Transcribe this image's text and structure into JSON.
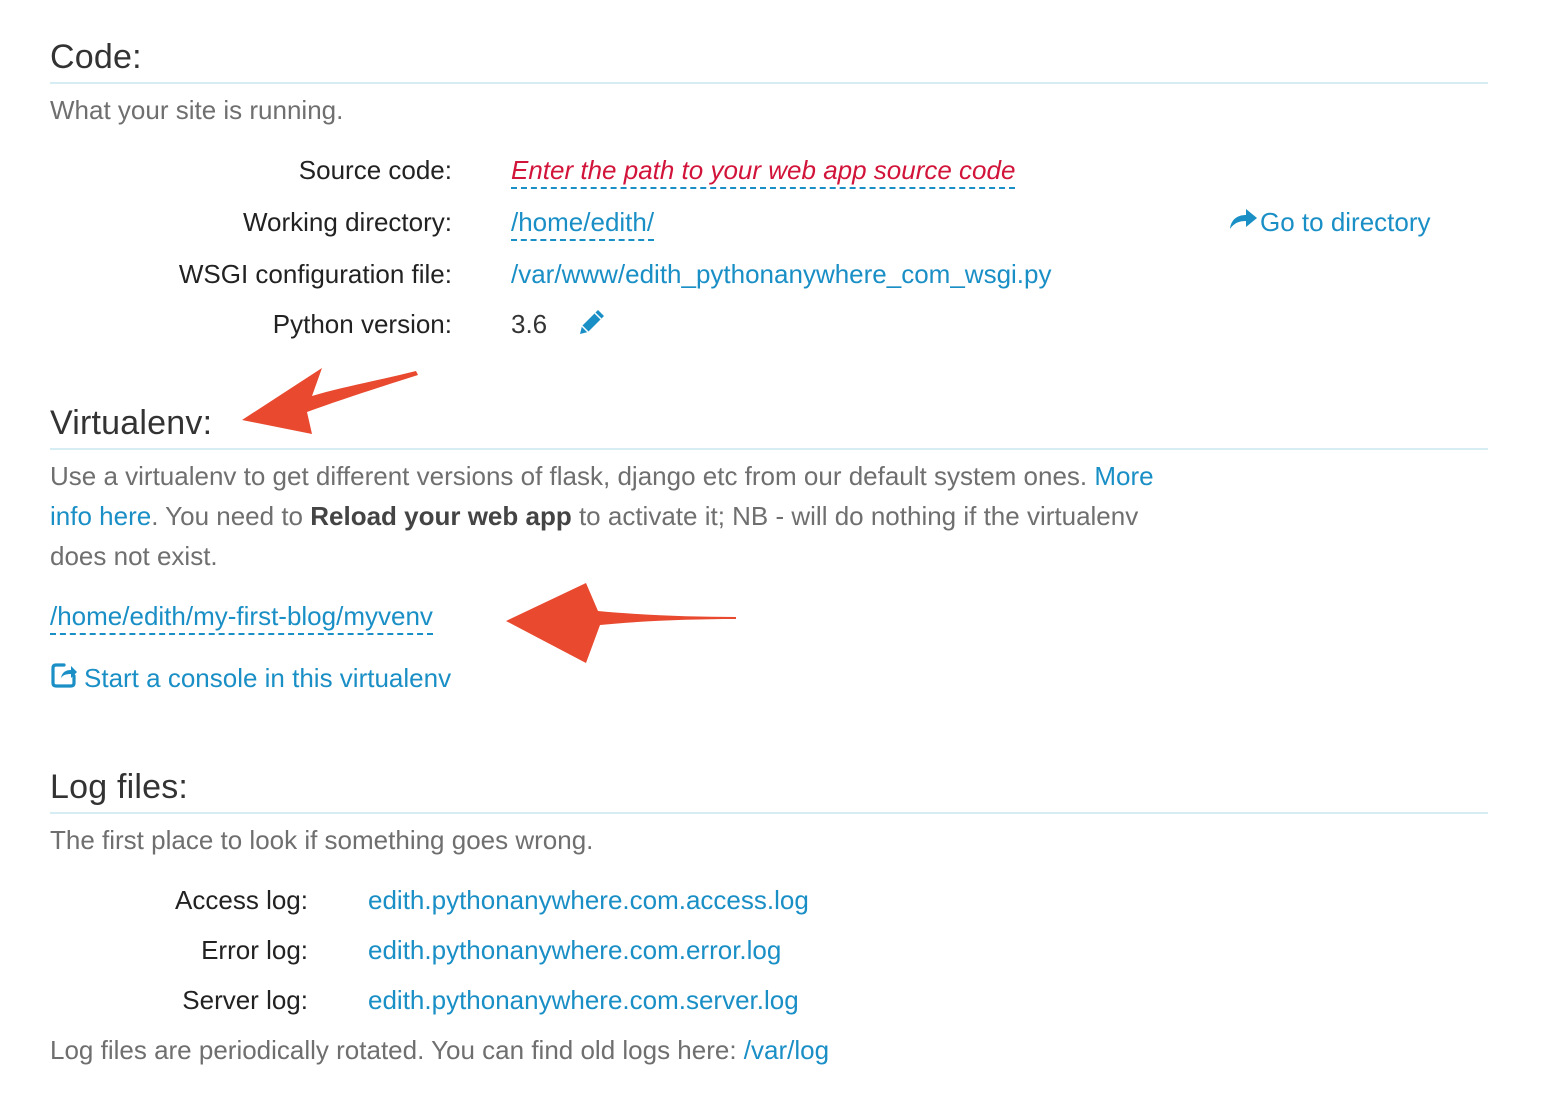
{
  "code": {
    "title": "Code:",
    "subtitle": "What your site is running.",
    "source_code": {
      "label": "Source code:",
      "value": "Enter the path to your web app source code"
    },
    "working_directory": {
      "label": "Working directory:",
      "value": "/home/edith/",
      "action": "Go to directory",
      "action_icon": "share-arrow-icon"
    },
    "wsgi": {
      "label": "WSGI configuration file:",
      "value": "/var/www/edith_pythonanywhere_com_wsgi.py"
    },
    "python_version": {
      "label": "Python version:",
      "value": "3.6",
      "edit_icon": "pencil-icon"
    }
  },
  "virtualenv": {
    "title": "Virtualenv:",
    "description_part1": "Use a virtualenv to get different versions of flask, django etc from our default system ones. ",
    "more_info_link": "More info here",
    "description_part2": ". You need to ",
    "reload_bold": "Reload your web app",
    "description_part3": " to activate it; NB - will do nothing if the virtualenv does not exist.",
    "path": "/home/edith/my-first-blog/myvenv",
    "console_link": "Start a console in this virtualenv",
    "console_icon": "external-link-icon"
  },
  "log_files": {
    "title": "Log files:",
    "subtitle": "The first place to look if something goes wrong.",
    "access_log": {
      "label": "Access log:",
      "value": "edith.pythonanywhere.com.access.log"
    },
    "error_log": {
      "label": "Error log:",
      "value": "edith.pythonanywhere.com.error.log"
    },
    "server_log": {
      "label": "Server log:",
      "value": "edith.pythonanywhere.com.server.log"
    },
    "footer_text": "Log files are periodically rotated. You can find old logs here: ",
    "footer_link": "/var/log"
  },
  "colors": {
    "link": "#1a8fc6",
    "placeholder": "#d2143a",
    "annotation_arrow": "#e8492f",
    "rule": "#d6eef3"
  }
}
